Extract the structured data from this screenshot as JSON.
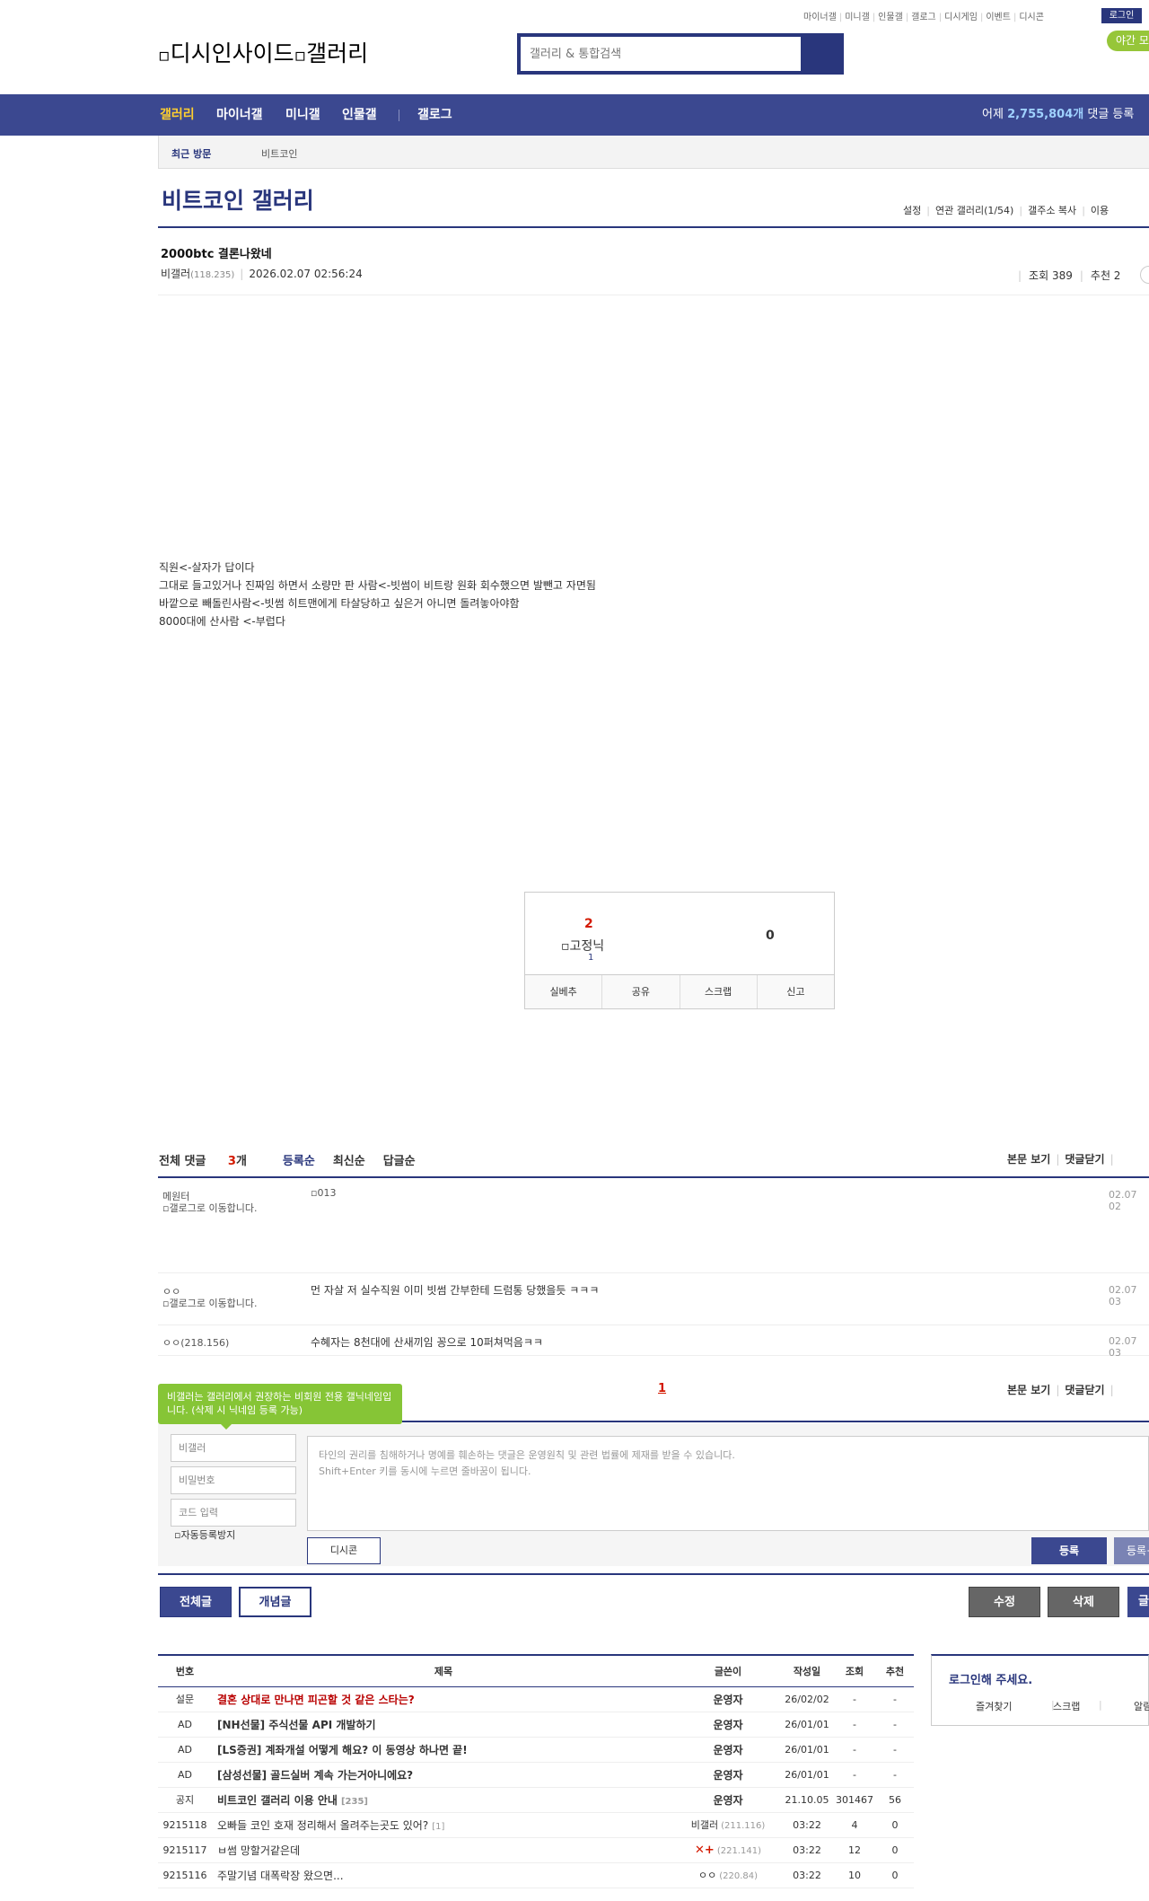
{
  "header": {
    "top_links": [
      "마이너갤",
      "미니갤",
      "인물갤",
      "갤로그",
      "디시게임",
      "이벤트",
      "디시콘"
    ],
    "login_label": "로그인",
    "logo_alt": "디시인사이드",
    "gallery_alt": "갤러리",
    "search_placeholder": "갤러리 & 통합검색",
    "pill_label": "야간 모드"
  },
  "nav": {
    "items": [
      "갤러리",
      "마이너갤",
      "미니갤",
      "인물갤",
      "갤로그"
    ],
    "stat_prefix": "어제",
    "stat_value": "2,755,804개",
    "stat_suffix": "댓글 등록"
  },
  "recent": {
    "label": "최근 방문",
    "item": "비트코인"
  },
  "gallery": {
    "title": "비트코인 갤러리",
    "tools": [
      "설정",
      "연관 갤러리(1/54)",
      "갤주소 복사",
      "이용"
    ]
  },
  "post": {
    "title": "2000btc 결론나왔네",
    "author": "비갤러",
    "author_ip": "(118.235)",
    "date": "2026.02.07 02:56:24",
    "views_label": "조회 389",
    "recommend_label": "추천 2",
    "content_lines": [
      "직원<-살자가 답이다",
      "그대로 들고있거나 진짜임 하면서 소량만 판 사람<-빗썸이 비트랑 원화 회수했으면 발뺀고 자면됨",
      "바깥으로 빼돌린사람<-빗썸 히트맨에게 타살당하고 싶은거 아니면 돌려놓아야함",
      "8000대에 산사람 <-부럽다"
    ]
  },
  "vote": {
    "up": "2",
    "fixed_alt": "고정닉",
    "fixed_count": "1",
    "down": "0",
    "buttons": [
      "실베추",
      "공유",
      "스크랩",
      "신고"
    ]
  },
  "comments": {
    "total_label": "전체 댓글",
    "total_count": "3",
    "total_unit": "개",
    "sort": [
      "등록순",
      "최신순",
      "답글순"
    ],
    "right": [
      "본문 보기",
      "댓글닫기"
    ],
    "items": [
      {
        "nick": "메원터",
        "icon_alt": "갤로그로 이동합니다.",
        "image_alt": "013",
        "text": "",
        "time": "02.07 02"
      },
      {
        "nick": "ㅇㅇ",
        "icon_alt": "갤로그로 이동합니다.",
        "text": "먼 자살 저 실수직원 이미 빗썸 간부한테 드럼통 당했을듯 ㅋㅋㅋ",
        "time": "02.07 03"
      },
      {
        "nick": "ㅇㅇ(218.156)",
        "text": "수혜자는 8천대에 산새끼임 꽁으로 10퍼쳐먹음ㅋㅋ",
        "time": "02.07 03"
      }
    ],
    "page": "1"
  },
  "write": {
    "tip": "비갤러는 갤러리에서 권장하는 비회원 전용 갤닉네임입니다. (삭제 시 닉네임 등록 가능)",
    "nick_value": "비갤러",
    "password_placeholder": "비밀번호",
    "code_placeholder": "코드 입력",
    "captcha_alt": "자동등록방지",
    "textarea_line1": "타인의 권리를 침해하거나 명예를 훼손하는 댓글은 운영원칙 및 관련 법률에 제재를 받을 수 있습니다.",
    "textarea_line2": "Shift+Enter 키를 동시에 누르면 줄바꿈이 됩니다.",
    "dccon": "디시콘",
    "submit": "등록",
    "submit2": "등록+추천"
  },
  "actions": {
    "all": "전체글",
    "concept": "개념글",
    "edit": "수정",
    "delete": "삭제",
    "write": "글쓰기"
  },
  "list": {
    "headers": [
      "번호",
      "제목",
      "글쓴이",
      "작성일",
      "조회",
      "추천"
    ],
    "rows": [
      {
        "num": "설문",
        "title": "결혼 상대로 만나면 피곤할 것 같은 스타는?",
        "writer": "운영자",
        "ip": "",
        "date": "26/02/02",
        "views": "-",
        "rec": "-",
        "cls": "notice red"
      },
      {
        "num": "AD",
        "title": "[NH선물] 주식선물 API 개발하기",
        "writer": "운영자",
        "ip": "",
        "date": "26/01/01",
        "views": "-",
        "rec": "-",
        "cls": "notice"
      },
      {
        "num": "AD",
        "title": "[LS증권] 계좌개설 어떻게 해요? 이 동영상 하나면 끝!",
        "writer": "운영자",
        "ip": "",
        "date": "26/01/01",
        "views": "-",
        "rec": "-",
        "cls": "notice"
      },
      {
        "num": "AD",
        "title": "[삼성선물] 골드실버 계속 가는거아니에요?",
        "writer": "운영자",
        "ip": "",
        "date": "26/01/01",
        "views": "-",
        "rec": "-",
        "cls": "notice"
      },
      {
        "num": "공지",
        "title": "비트코인 갤러리 이용 안내",
        "reply": "[235]",
        "writer": "운영자",
        "ip": "",
        "date": "21.10.05",
        "views": "301467",
        "rec": "56",
        "cls": "notice"
      },
      {
        "num": "9215118",
        "title": "오빠들 코인 호재 정리해서 올려주는곳도 있어?",
        "reply": "[1]",
        "writer": "비갤러",
        "ip": "(211.116)",
        "date": "03:22",
        "views": "4",
        "rec": "0",
        "cls": "normal"
      },
      {
        "num": "9215117",
        "title": "ㅂ썸 망할거같은데",
        "writer": "✕+",
        "ip": "(221.141)",
        "date": "03:22",
        "views": "12",
        "rec": "0",
        "cls": "normal x"
      },
      {
        "num": "9215116",
        "title": "주말기념 대폭락장 왔으면...",
        "writer": "ㅇㅇ",
        "ip": "(220.84)",
        "date": "03:22",
        "views": "10",
        "rec": "0",
        "cls": "normal"
      }
    ]
  },
  "loginbox": {
    "title": "로그인해 주세요.",
    "links": [
      "즐겨찾기",
      "스크랩",
      "알림"
    ]
  },
  "colors": {
    "brand": "#3b4890",
    "brand_dark": "#29367c",
    "accent_yellow": "#ffcf2f",
    "alert_red": "#d31900",
    "tip_green": "#86c536"
  }
}
